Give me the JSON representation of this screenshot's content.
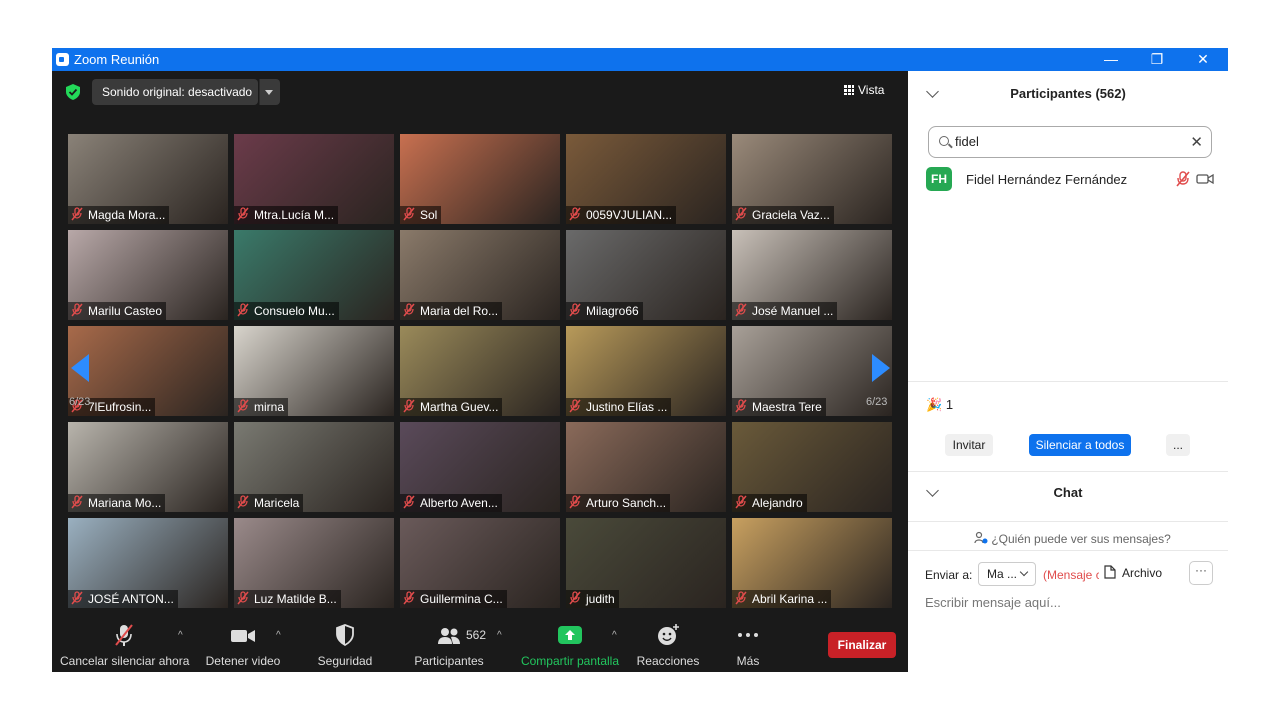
{
  "window": {
    "title": "Zoom Reunión",
    "minimize": "—",
    "restore": "❐",
    "close": "✕"
  },
  "meeting": {
    "sound_label": "Sonido original: desactivado",
    "view_label": "Vista",
    "page_left": "6/23",
    "page_right": "6/23",
    "tiles": [
      {
        "name": "Magda Mora...",
        "bg": "#8a8278"
      },
      {
        "name": "Mtra.Lucía M...",
        "bg": "#6b3b4a"
      },
      {
        "name": "Sol",
        "bg": "#c87050"
      },
      {
        "name": "0059VJULIAN...",
        "bg": "#7a5a3a"
      },
      {
        "name": "Graciela Vaz...",
        "bg": "#9a8a7a"
      },
      {
        "name": "Marilu Casteo",
        "bg": "#b8a8a8"
      },
      {
        "name": "Consuelo Mu...",
        "bg": "#3a7a6a"
      },
      {
        "name": "Maria del Ro...",
        "bg": "#8a7a6a"
      },
      {
        "name": "Milagro66",
        "bg": "#6a6a6a"
      },
      {
        "name": "José Manuel ...",
        "bg": "#c8c0b8"
      },
      {
        "name": "7lEufrosin...",
        "bg": "#a86a4a"
      },
      {
        "name": "mirna",
        "bg": "#d8d4cc"
      },
      {
        "name": "Martha Guev...",
        "bg": "#9a8a5a"
      },
      {
        "name": "Justino Elías ...",
        "bg": "#b89a5a"
      },
      {
        "name": "Maestra Tere",
        "bg": "#a8a098"
      },
      {
        "name": "Mariana Mo...",
        "bg": "#b8b4ac"
      },
      {
        "name": "Maricela",
        "bg": "#7a7a72"
      },
      {
        "name": "Alberto Aven...",
        "bg": "#5a4a5a"
      },
      {
        "name": "Arturo Sanch...",
        "bg": "#8a6a5a"
      },
      {
        "name": "Alejandro",
        "bg": "#6a5a3a"
      },
      {
        "name": "JOSÉ ANTON...",
        "bg": "#9ab0c0"
      },
      {
        "name": "Luz Matilde B...",
        "bg": "#9a8a8a"
      },
      {
        "name": "Guillermina C...",
        "bg": "#6a5a5a"
      },
      {
        "name": "judith",
        "bg": "#4a4a3a"
      },
      {
        "name": "Abril Karina ...",
        "bg": "#c8a060"
      }
    ]
  },
  "toolbar": {
    "mute_label": "Cancelar silenciar ahora",
    "video_label": "Detener video",
    "security_label": "Seguridad",
    "participants_label": "Participantes",
    "participants_count": "562",
    "share_label": "Compartir pantalla",
    "reactions_label": "Reacciones",
    "more_label": "Más",
    "end_label": "Finalizar"
  },
  "participants_panel": {
    "title": "Participantes (562)",
    "search_value": "fidel",
    "result": {
      "initials": "FH",
      "name": "Fidel Hernández Fernández"
    },
    "reaction_count": "1",
    "invite_label": "Invitar",
    "mute_all_label": "Silenciar a todos",
    "more_label": "..."
  },
  "chat": {
    "title": "Chat",
    "who_can_see": "¿Quién puede ver sus mensajes?",
    "send_to_label": "Enviar a:",
    "recipient": "Ma ...",
    "private_label": "(Mensaje c",
    "file_label": "Archivo",
    "more_label": "···",
    "placeholder": "Escribir mensaje aquí..."
  },
  "colors": {
    "accent": "#0e72ed",
    "share_green": "#22c55e",
    "end_red": "#c82127",
    "avatar_green": "#26a853",
    "arrow_blue": "#2d8cff"
  }
}
